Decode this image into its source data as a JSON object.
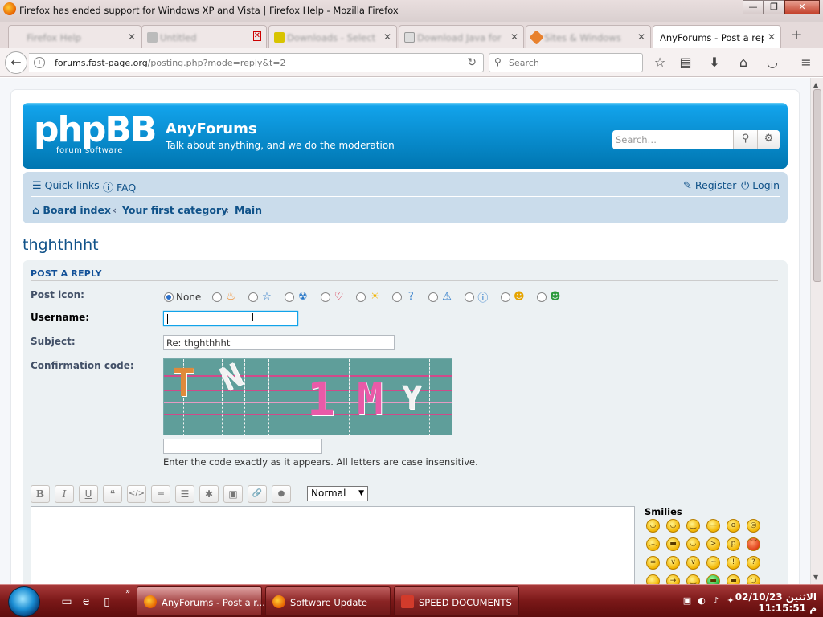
{
  "window": {
    "title": "Firefox has ended support for Windows XP and Vista | Firefox Help - Mozilla Firefox",
    "minimize": "—",
    "maximize": "❐",
    "close": "✕"
  },
  "tabs": [
    {
      "label": "Firefox Help",
      "active": false
    },
    {
      "label": "Untitled",
      "active": false
    },
    {
      "label": "Downloads - Select",
      "active": false
    },
    {
      "label": "Download Java for",
      "active": false
    },
    {
      "label": "Sites & Windows",
      "active": false
    },
    {
      "label": "AnyForums - Post a reply",
      "active": true
    }
  ],
  "nav": {
    "url_host": "forums.fast-page.org",
    "url_path": "/posting.php?mode=reply&t=2",
    "search_placeholder": "Search"
  },
  "forum": {
    "site_title": "AnyForums",
    "site_description": "Talk about anything, and we do the moderation",
    "logo_main": "phpBB",
    "logo_sub": "forum  software",
    "search_placeholder": "Search…",
    "quick_links": "Quick links",
    "faq": "FAQ",
    "register": "Register",
    "login": "Login",
    "breadcrumbs": [
      "Board index",
      "Your first category",
      "Main"
    ],
    "topic_title": "thghthhht"
  },
  "post": {
    "heading": "POST A REPLY",
    "post_icon_label": "Post icon:",
    "none_label": "None",
    "username_label": "Username:",
    "username_value": "",
    "subject_label": "Subject:",
    "subject_value": "Re: thghthhht",
    "confirm_label": "Confirmation code:",
    "confirm_value": "",
    "confirm_hint": "Enter the code exactly as it appears. All letters are case insensitive.",
    "font_size_value": "Normal",
    "smilies_title": "Smilies"
  },
  "toolbar_buttons": [
    "B",
    "I",
    "U",
    "❝",
    "</>",
    "≡",
    "☰",
    "✱",
    "▣",
    "🔗",
    "●"
  ],
  "taskbar": {
    "items": [
      {
        "label": "AnyForums - Post a r...",
        "active": true
      },
      {
        "label": "Software Update",
        "active": false
      },
      {
        "label": "SPEED DOCUMENTS",
        "active": false
      }
    ],
    "day": "الاثنين",
    "date": "02/10/23",
    "time": "11:15:51",
    "ampm": "م"
  },
  "colors": {
    "header_blue": "#0076b1",
    "link_blue": "#105289",
    "taskbar_red": "#7a1818"
  }
}
